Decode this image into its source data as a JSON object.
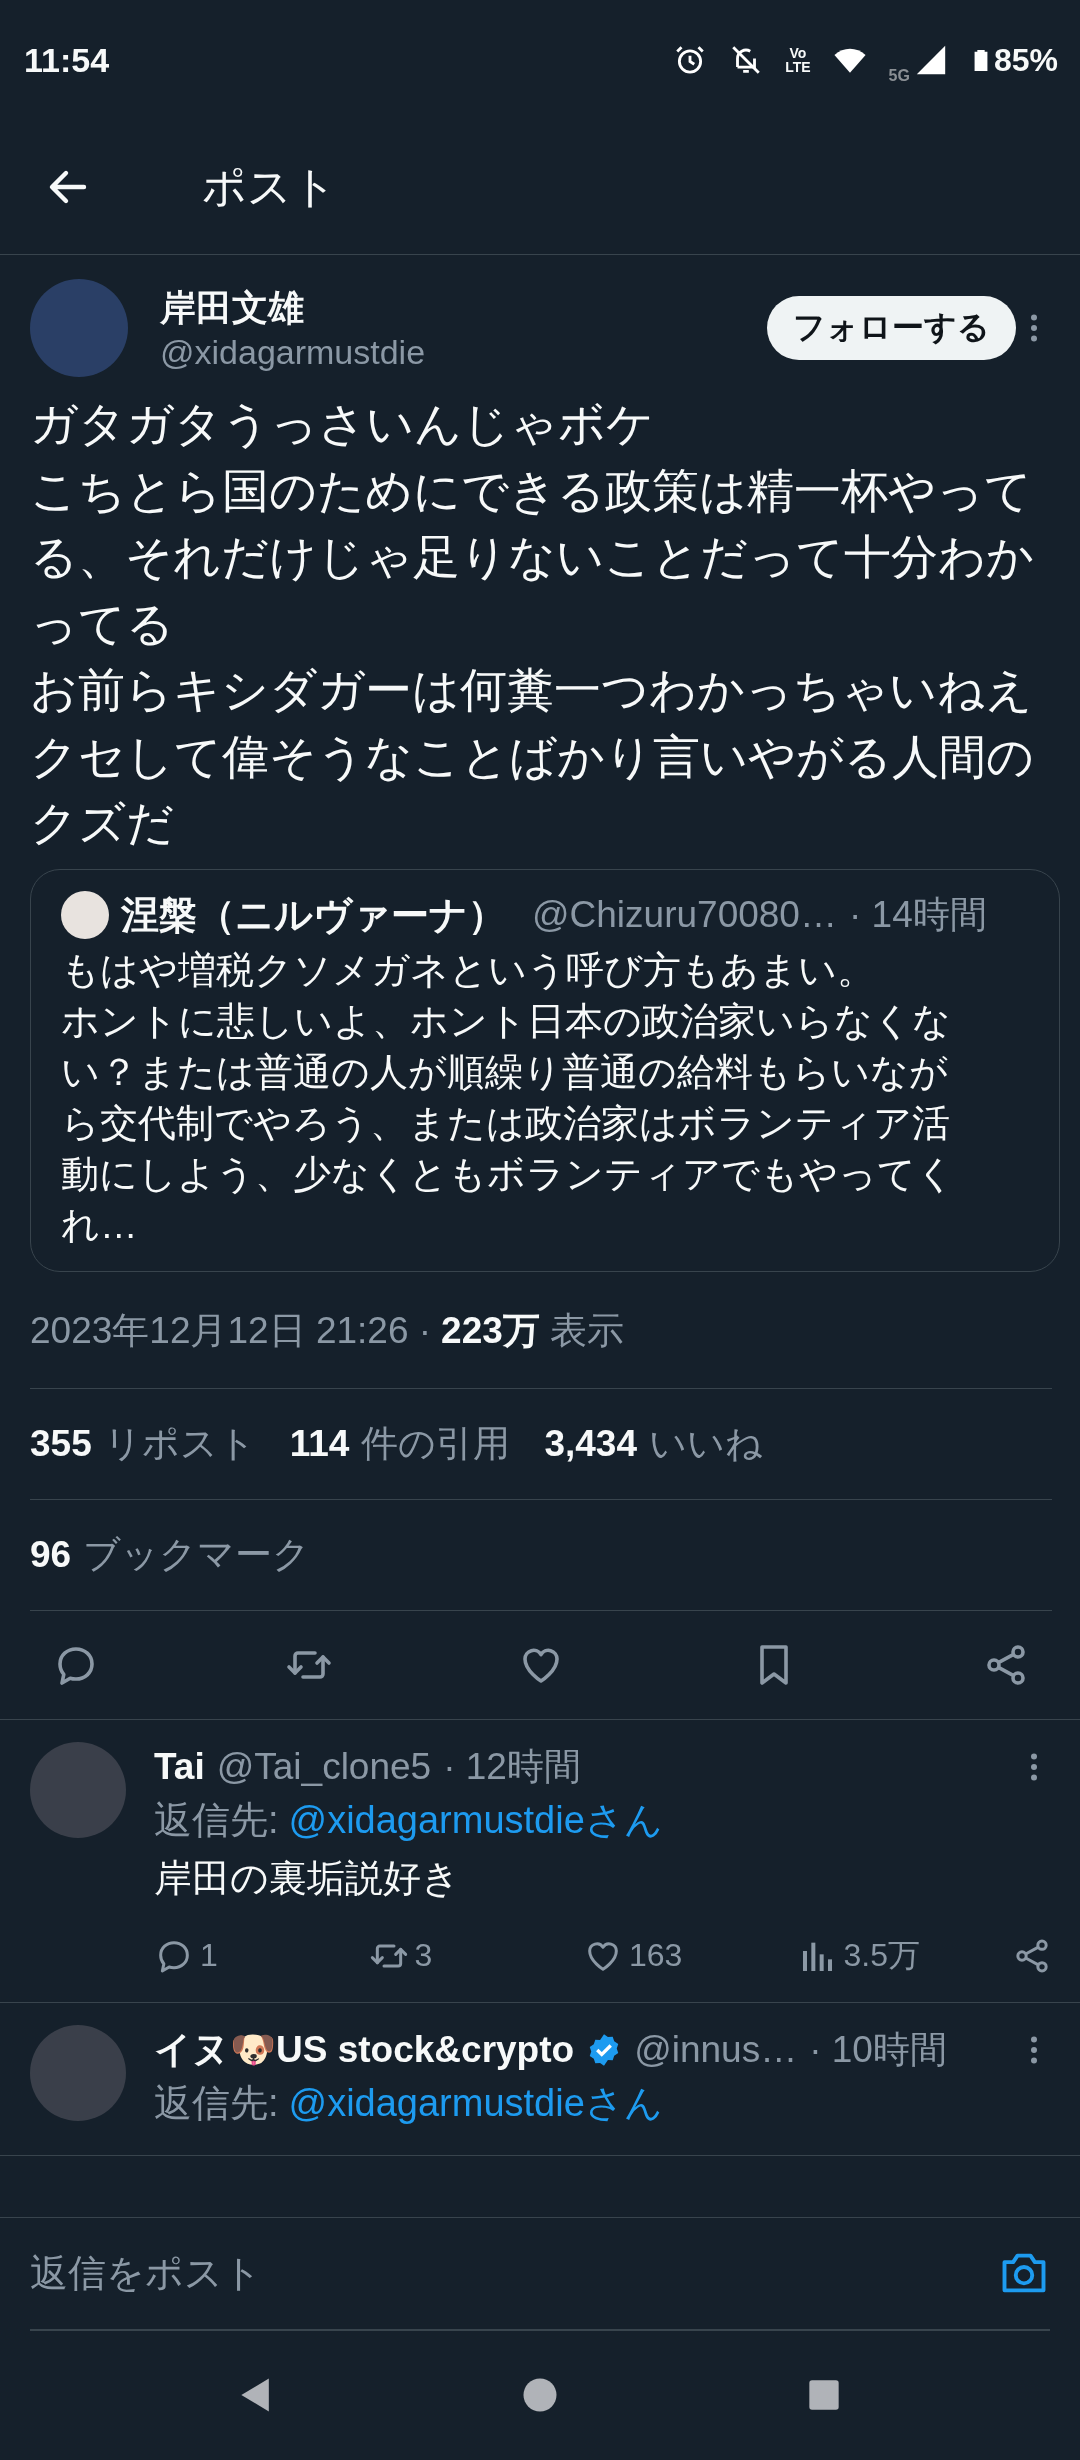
{
  "status_bar": {
    "time": "11:54",
    "volte": [
      "Vo",
      "LTE"
    ],
    "network": "5G",
    "battery": "85%"
  },
  "header": {
    "title": "ポスト"
  },
  "post": {
    "author": {
      "name": "岸田文雄",
      "handle": "@xidagarmustdie"
    },
    "follow_button": "フォローする",
    "text": [
      "ガタガタうっさいんじゃボケ",
      "こちとら国のためにできる政策は精一杯やってる、それだけじゃ足りないことだって十分わかってる",
      "お前らキシダガーは何糞一つわかっちゃいねえクセして偉そうなことばかり言いやがる人間のクズだ"
    ],
    "quote": {
      "name": "涅槃（ニルヴァーナ）",
      "handle": "@Chizuru70080…",
      "time": "· 14時間",
      "text": [
        "もはや増税クソメガネという呼び方もあまい。",
        "ホントに悲しいよ、ホント日本の政治家いらなくない？または普通の人が順繰り普通の給料もらいながら交代制でやろう、または政治家はボランティア活動にしよう、少なくともボランティアでもやってくれ…"
      ]
    },
    "timestamp": "2023年12月12日 21:26 ·",
    "views": {
      "count": "223万",
      "label": "表示"
    },
    "stats": [
      {
        "count": "355",
        "label": "リポスト"
      },
      {
        "count": "114",
        "label": "件の引用"
      },
      {
        "count": "3,434",
        "label": "いいね"
      }
    ],
    "bookmarks": {
      "count": "96",
      "label": "ブックマーク"
    },
    "actions": [
      {
        "kind": "reply"
      },
      {
        "kind": "repost"
      },
      {
        "kind": "like"
      },
      {
        "kind": "bookmark"
      },
      {
        "kind": "share"
      }
    ]
  },
  "replies": [
    {
      "name": "Tai",
      "verified": false,
      "handle": "@Tai_clone5",
      "time": "· 12時間",
      "reply_to_label": "返信先:",
      "reply_to": "@xidagarmustdieさん",
      "text": "岸田の裏垢説好き",
      "stats": [
        {
          "kind": "reply",
          "count": "1"
        },
        {
          "kind": "repost",
          "count": "3"
        },
        {
          "kind": "like",
          "count": "163"
        },
        {
          "kind": "views",
          "count": "3.5万"
        },
        {
          "kind": "share"
        }
      ]
    },
    {
      "name": "イヌ🐶US stock&crypto",
      "verified": true,
      "handle": "@innus…",
      "time": "· 10時間",
      "reply_to_label": "返信先:",
      "reply_to": "@xidagarmustdieさん"
    }
  ],
  "reply_bar": {
    "placeholder": "返信をポスト"
  }
}
